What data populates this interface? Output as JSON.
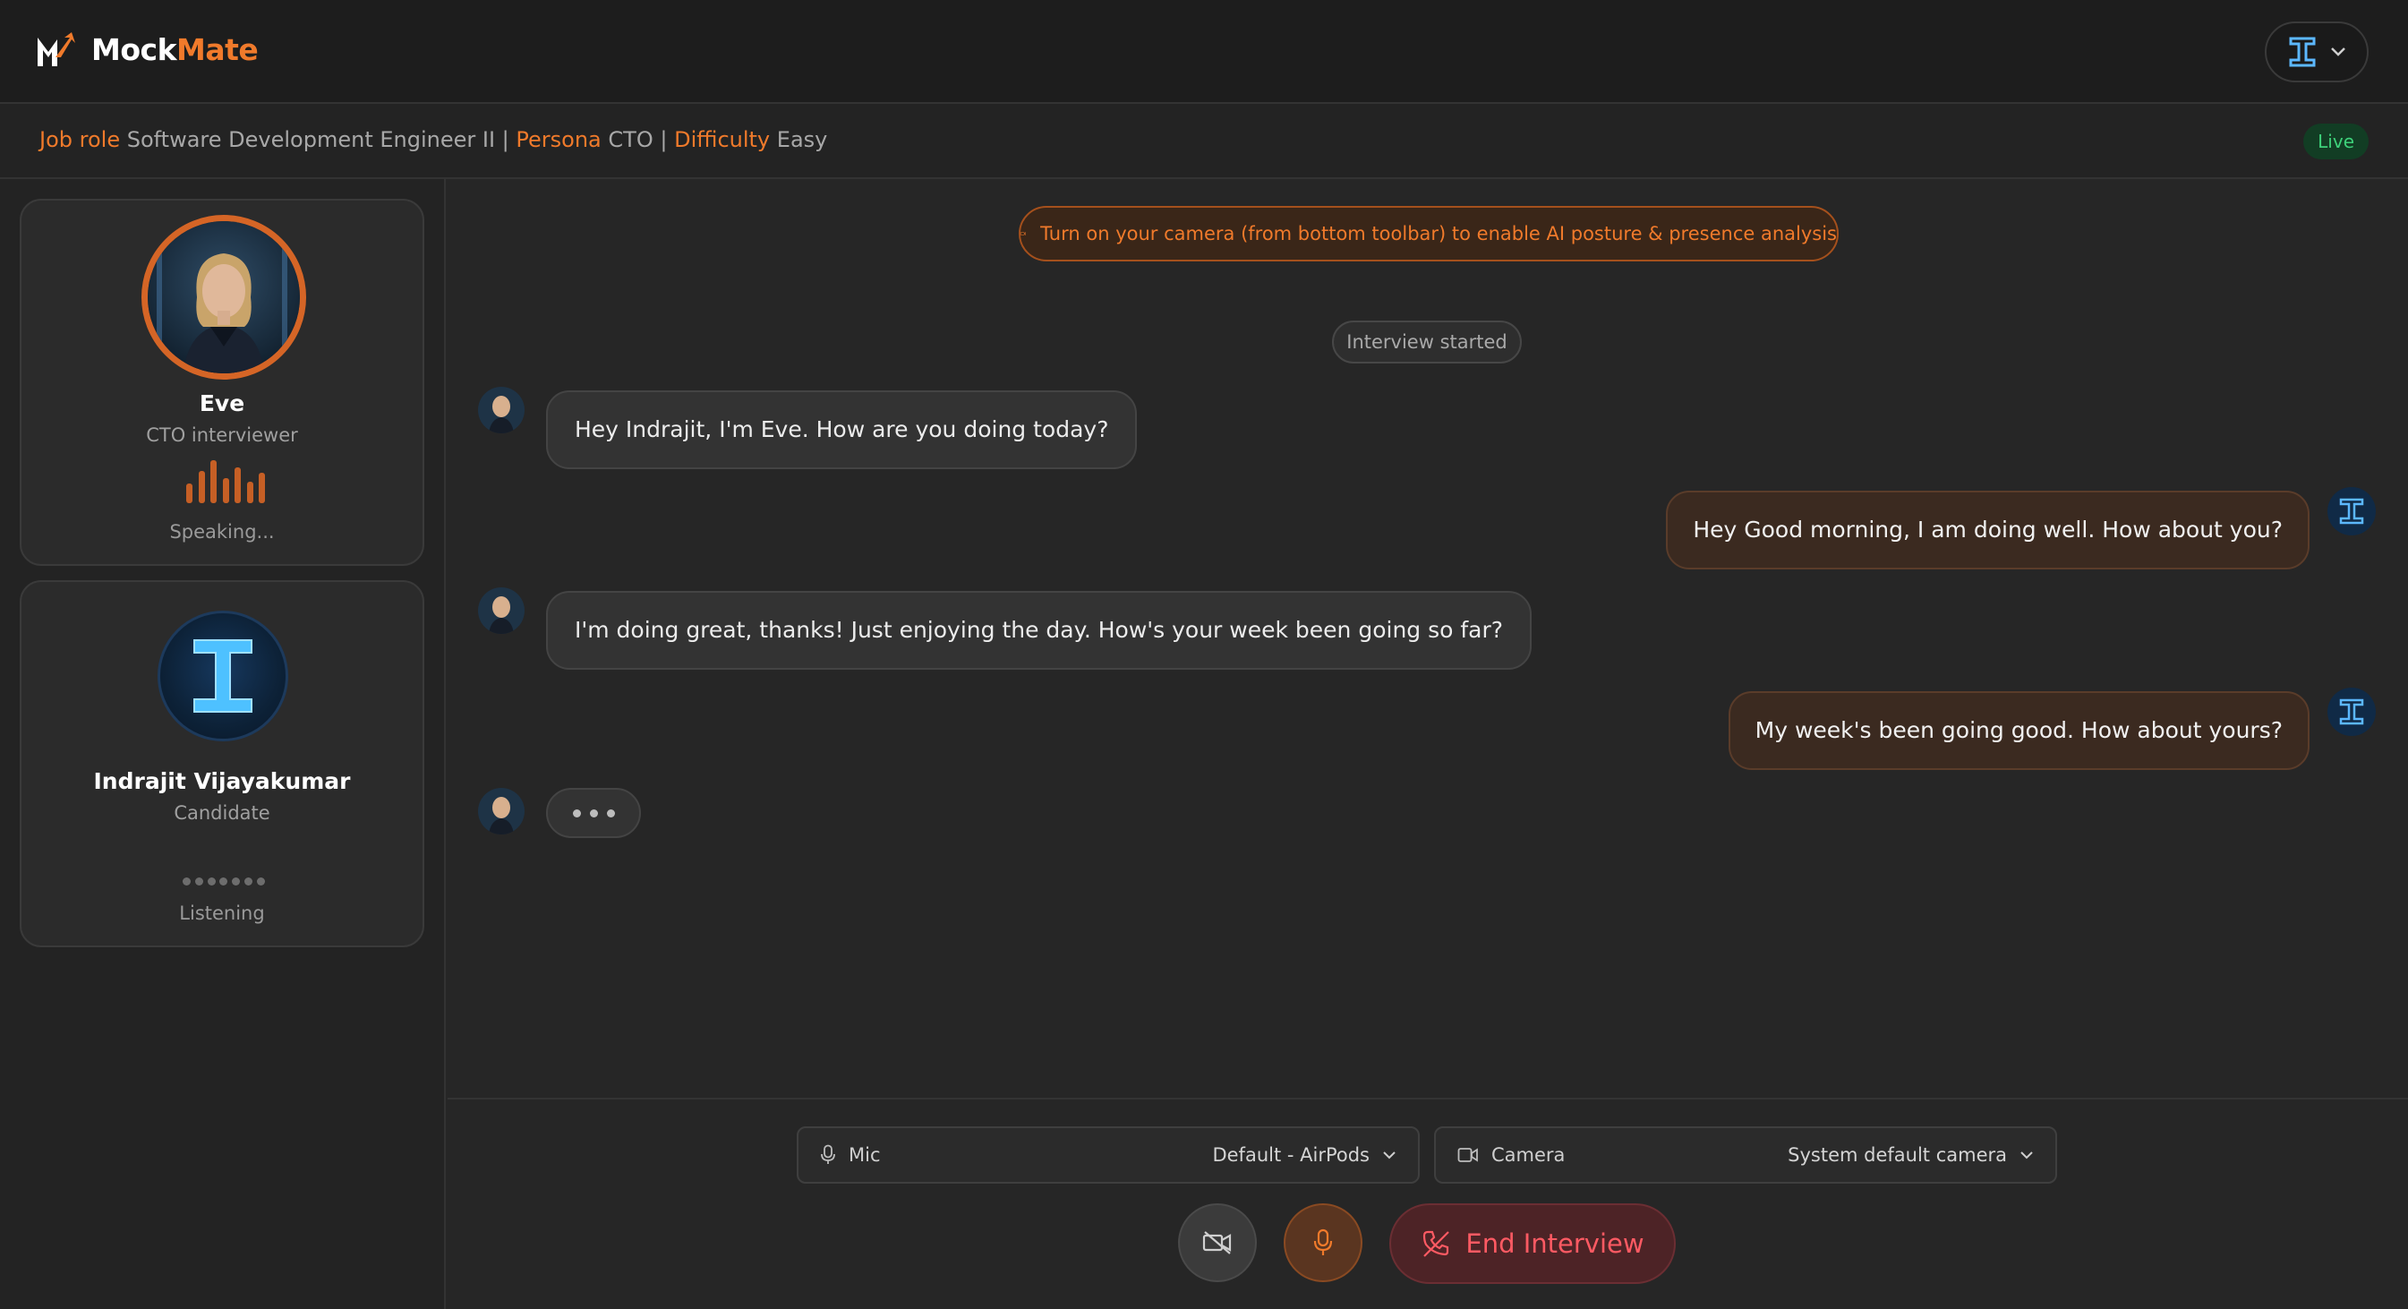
{
  "app": {
    "name_part1": "Mock",
    "name_part2": "Mate",
    "accent": "#f07a2b"
  },
  "user_menu": {
    "initial_icon": "i-monogram-icon",
    "chevron": "chevron-down-icon"
  },
  "session": {
    "job_role_key": "Job role",
    "job_role": "Software Development Engineer II",
    "persona_key": "Persona",
    "persona": "CTO",
    "difficulty_key": "Difficulty",
    "difficulty": "Easy",
    "separator": "|",
    "status_badge": "Live"
  },
  "interviewer": {
    "name": "Eve",
    "role": "CTO interviewer",
    "status": "Speaking..."
  },
  "candidate": {
    "name": "Indrajit Vijayakumar",
    "role": "Candidate",
    "status": "Listening"
  },
  "notice": "Turn on your camera (from bottom toolbar) to enable AI posture & presence analysis",
  "chat": {
    "started_label": "Interview started",
    "messages": [
      {
        "from": "ai",
        "text": "Hey Indrajit, I'm Eve. How are you doing today?"
      },
      {
        "from": "user",
        "text": "Hey Good morning, I am doing well. How about you?"
      },
      {
        "from": "ai",
        "text": "I'm doing great, thanks! Just enjoying the day. How's your week been going so far?"
      },
      {
        "from": "user",
        "text": "My week's been going good. How about yours?"
      }
    ]
  },
  "controls": {
    "mic_label": "Mic",
    "mic_value": "Default - AirPods",
    "camera_label": "Camera",
    "camera_value": "System default camera",
    "end_label": "End Interview"
  }
}
